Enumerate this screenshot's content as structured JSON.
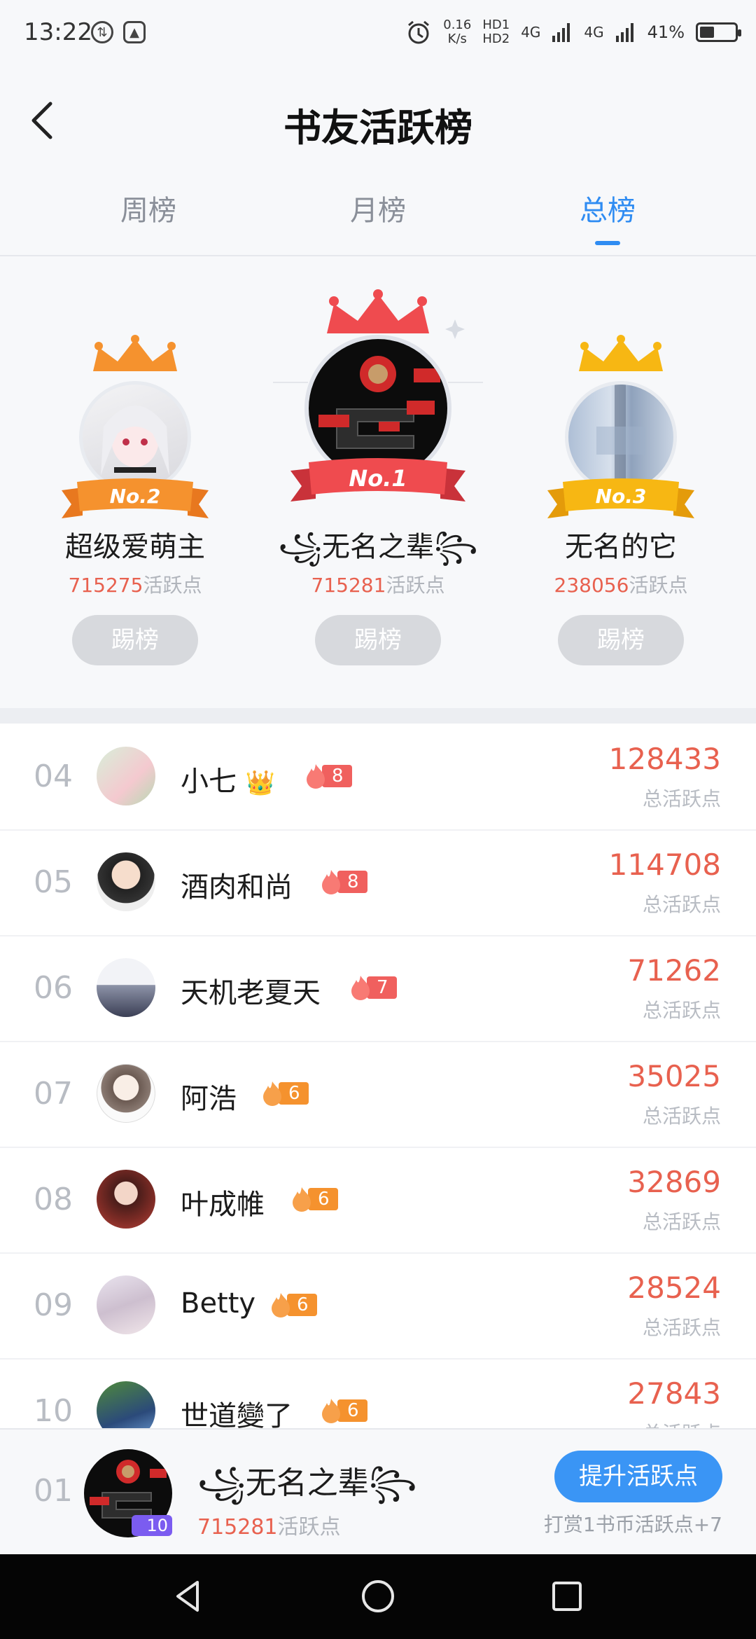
{
  "status_bar": {
    "time": "13:22",
    "net_speed": "0.16",
    "net_unit": "K/s",
    "hd1": "HD1",
    "hd2": "HD2",
    "sig1": "4G",
    "sig2": "4G",
    "battery": "41%",
    "battery_level": 0.41
  },
  "header": {
    "back_icon": "back-arrow-icon",
    "title": "书友活跃榜"
  },
  "tabs": [
    {
      "label": "周榜"
    },
    {
      "label": "月榜"
    },
    {
      "label": "总榜"
    }
  ],
  "active_tab": "总榜",
  "podium": {
    "first": {
      "rank": "No.1",
      "name": "꧁无名之辈꧂",
      "points": "715281",
      "points_suffix": "活跃点",
      "button": "踢榜"
    },
    "second": {
      "rank": "No.2",
      "name": "超级爱萌主",
      "points": "715275",
      "points_suffix": "活跃点",
      "button": "踢榜"
    },
    "third": {
      "rank": "No.3",
      "name": "无名的它",
      "points": "238056",
      "points_suffix": "活跃点",
      "button": "踢榜"
    }
  },
  "list": [
    {
      "rank": "04",
      "name": "小七",
      "crown": "👑",
      "level": "8",
      "score": "128433",
      "score_label": "总活跃点"
    },
    {
      "rank": "05",
      "name": "酒肉和尚",
      "level": "8",
      "score": "114708",
      "score_label": "总活跃点"
    },
    {
      "rank": "06",
      "name": "天机老夏天",
      "level": "7",
      "score": "71262",
      "score_label": "总活跃点"
    },
    {
      "rank": "07",
      "name": "阿浩",
      "level": "6",
      "score": "35025",
      "score_label": "总活跃点"
    },
    {
      "rank": "08",
      "name": "叶成帷",
      "level": "6",
      "score": "32869",
      "score_label": "总活跃点"
    },
    {
      "rank": "09",
      "name": "Betty",
      "level": "6",
      "score": "28524",
      "score_label": "总活跃点"
    },
    {
      "rank": "10",
      "name": "世道變了",
      "level": "6",
      "score": "27843",
      "score_label": "总活跃点"
    }
  ],
  "my_entry": {
    "rank": "01",
    "name": "꧁无名之辈꧂",
    "level": "10",
    "points": "715281",
    "points_suffix": "活跃点",
    "boost_button": "提升活跃点",
    "hint": "打赏1书币活跃点+7"
  },
  "colors": {
    "accent": "#2f8cf2",
    "score_red": "#e8614f",
    "badge_red": "#f0605e",
    "badge_orange": "#f5922e",
    "level_purple": "#7b5cf0"
  },
  "nav": {
    "back": "nav-back-icon",
    "home": "nav-home-icon",
    "recent": "nav-recent-icon"
  }
}
